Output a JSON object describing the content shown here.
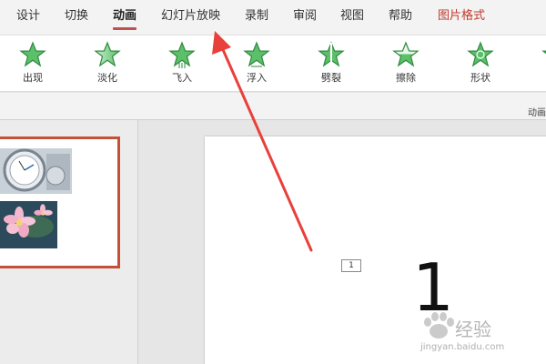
{
  "ribbon_tabs": [
    {
      "label": "设计"
    },
    {
      "label": "切换"
    },
    {
      "label": "动画",
      "active": true
    },
    {
      "label": "幻灯片放映"
    },
    {
      "label": "录制"
    },
    {
      "label": "审阅"
    },
    {
      "label": "视图"
    },
    {
      "label": "帮助"
    },
    {
      "label": "图片格式",
      "contextual": true
    }
  ],
  "animation_effects": [
    {
      "label": "出现",
      "icon": "star-icon"
    },
    {
      "label": "淡化",
      "icon": "star-faded-icon"
    },
    {
      "label": "飞入",
      "icon": "star-fly-icon"
    },
    {
      "label": "浮入",
      "icon": "star-icon"
    },
    {
      "label": "劈裂",
      "icon": "star-split-icon"
    },
    {
      "label": "擦除",
      "icon": "star-wipe-icon"
    },
    {
      "label": "形状",
      "icon": "star-shape-icon"
    }
  ],
  "group_label": "动画",
  "slide": {
    "animation_order_tag": "1",
    "content_text": "1"
  },
  "watermark": {
    "text": "经验",
    "subtext": "jingyan.baidu.com"
  },
  "colors": {
    "accent": "#c0504d",
    "contextual_tab": "#c0392b",
    "thumbnail_border": "#c45037",
    "arrow": "#e8403a",
    "star_fill": "#5cbf6a",
    "star_stroke": "#2f8a3f"
  }
}
